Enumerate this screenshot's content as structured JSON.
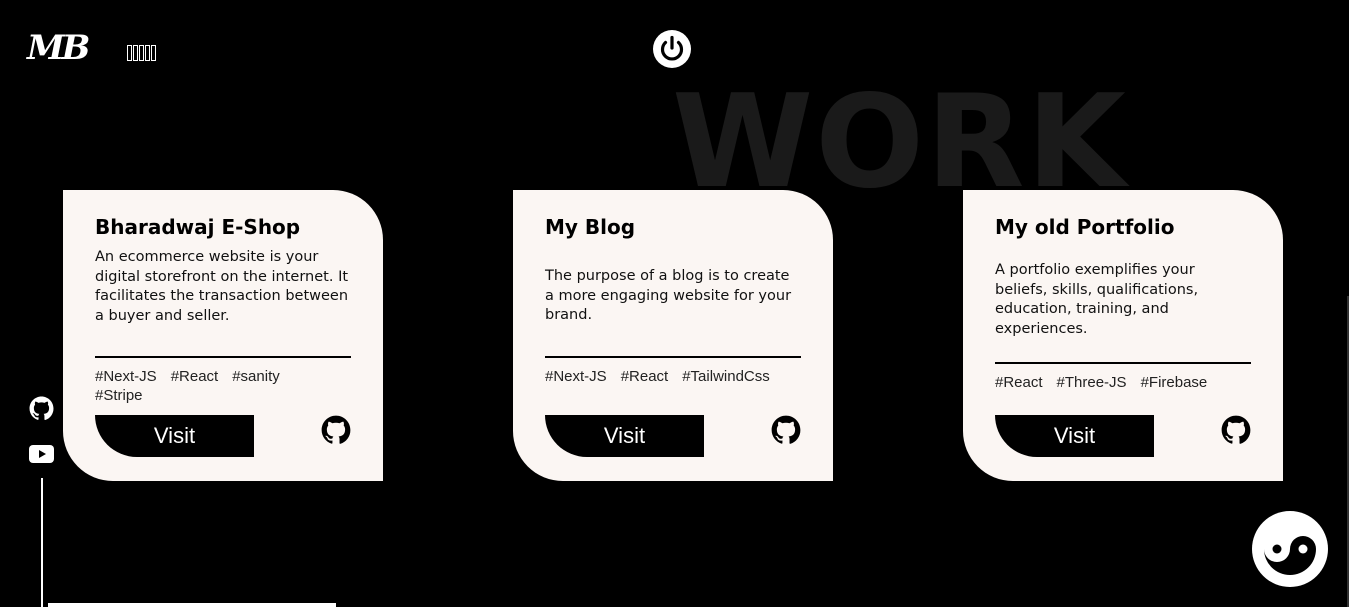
{
  "header": {
    "logo": "MB",
    "power_icon": "power-icon"
  },
  "background_title": "WORK",
  "social": {
    "github_icon": "github-icon",
    "youtube_icon": "youtube-icon"
  },
  "cards": [
    {
      "title": "Bharadwaj E-Shop",
      "description": "An ecommerce website is your digital storefront on the internet. It facilitates the transaction between a buyer and seller.",
      "tags": [
        "#Next-JS",
        "#React",
        "#sanity",
        "#Stripe"
      ],
      "visit_label": "Visit"
    },
    {
      "title": "My Blog",
      "description": "The purpose of a blog is to create a more engaging website for your brand.",
      "tags": [
        "#Next-JS",
        "#React",
        "#TailwindCss"
      ],
      "visit_label": "Visit"
    },
    {
      "title": "My old Portfolio",
      "description": "A portfolio exemplifies your beliefs, skills, qualifications, education, training, and experiences.",
      "tags": [
        "#React",
        "#Three-JS",
        "#Firebase"
      ],
      "visit_label": "Visit"
    }
  ],
  "theme_toggle_icon": "yin-yang-icon",
  "colors": {
    "background": "#000000",
    "card": "#fbf6f3",
    "accent": "#000000"
  }
}
